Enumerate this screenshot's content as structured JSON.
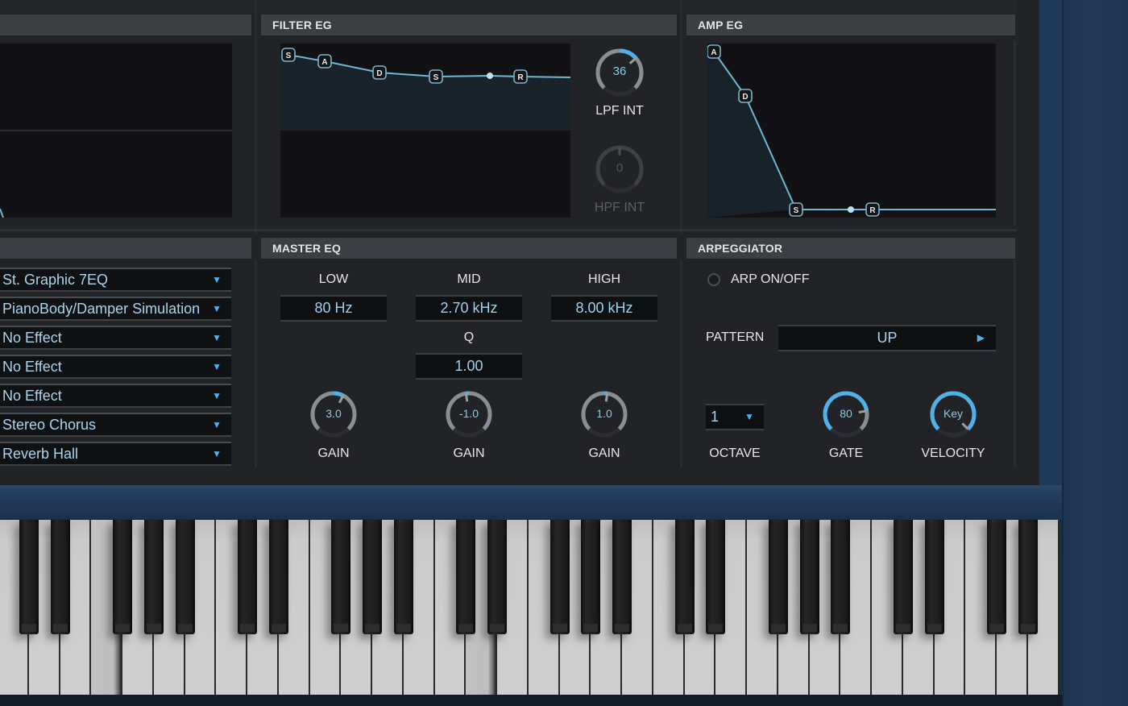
{
  "sections": {
    "filter_eg": "FILTER EG",
    "amp_eg": "AMP EG",
    "master_eq": "MASTER EQ",
    "arpeggiator": "ARPEGGIATOR"
  },
  "filter_eg": {
    "nodes": [
      "S",
      "A",
      "D",
      "S",
      "R"
    ],
    "lpf_int": {
      "label": "LPF INT",
      "value": "36",
      "fraction": 0.68
    },
    "hpf_int": {
      "label": "HPF INT",
      "value": "0",
      "fraction": 0.5
    }
  },
  "amp_eg": {
    "nodes": [
      "A",
      "D",
      "S",
      "R"
    ]
  },
  "effects": [
    {
      "label": "St. Graphic 7EQ"
    },
    {
      "label": "PianoBody/Damper Simulation"
    },
    {
      "label": "No Effect"
    },
    {
      "label": "No Effect"
    },
    {
      "label": "No Effect"
    },
    {
      "label": "Stereo Chorus"
    },
    {
      "label": "Reverb Hall"
    }
  ],
  "icons": {
    "dropdown": "▼",
    "play": "▶"
  },
  "master_eq": {
    "low": {
      "label": "LOW",
      "freq": "80 Hz",
      "gain_label": "GAIN",
      "gain": "3.0",
      "fraction": 0.6
    },
    "mid": {
      "label": "MID",
      "freq": "2.70 kHz",
      "q_label": "Q",
      "q": "1.00",
      "gain_label": "GAIN",
      "gain": "-1.0",
      "fraction": 0.47
    },
    "high": {
      "label": "HIGH",
      "freq": "8.00 kHz",
      "gain_label": "GAIN",
      "gain": "1.0",
      "fraction": 0.53
    }
  },
  "arpeggiator": {
    "onoff_label": "ARP ON/OFF",
    "onoff": false,
    "pattern_label": "PATTERN",
    "pattern": "UP",
    "octave": "1",
    "octave_label": "OCTAVE",
    "gate": {
      "label": "GATE",
      "value": "80",
      "fraction": 0.8
    },
    "velocity": {
      "label": "VELOCITY",
      "value": "Key",
      "fraction": 1.0
    }
  },
  "keyboard": {
    "white_keys": 34,
    "pressed_white_keys": [
      3,
      15
    ]
  },
  "colors": {
    "accent": "#4fb0ea",
    "track": "#8a8d91",
    "value_text": "#9fd0ec"
  }
}
